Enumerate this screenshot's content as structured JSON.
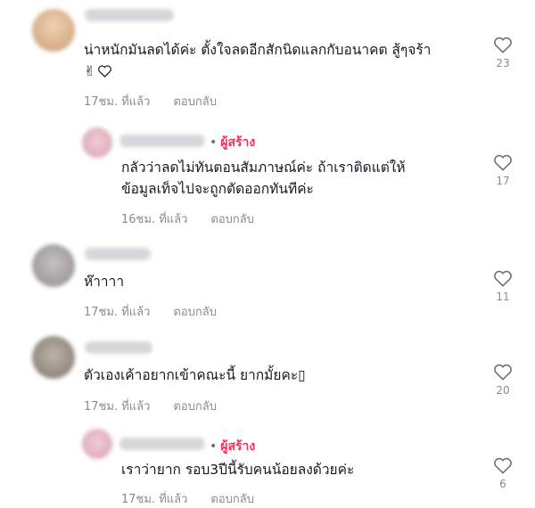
{
  "comments": [
    {
      "line1": "น่าหนักมันลดได้ค่ะ ตั้งใจลดอีกสักนิดแลกกับอนาคต สู้ๆจร้า",
      "line2": "✌",
      "time": "17ชม. ที่แล้ว",
      "reply": "ตอบกลับ",
      "likes": "23",
      "avatar_color": "#d9b48f"
    },
    {
      "creator_label": "ผู้สร้าง",
      "line1": "กลัวว่าลดไม่ทันตอนสัมภาษณ์ค่ะ ถ้าเราติดแต่ให้",
      "line2": "ข้อมูลเท็จไปจะถูกตัดออกทันทีค่ะ",
      "time": "16ชม. ที่แล้ว",
      "reply": "ตอบกลับ",
      "likes": "17",
      "avatar_color": "#e3b9c4"
    },
    {
      "line1": "ห๊าาาา",
      "time": "17ชม. ที่แล้ว",
      "reply": "ตอบกลับ",
      "likes": "11",
      "avatar_color": "#a9a5a5"
    },
    {
      "line1": "ตัวเองเค้าอยากเข้าคณะนี้ ยากมั้ยคะ▯",
      "time": "17ชม. ที่แล้ว",
      "reply": "ตอบกลับ",
      "likes": "20",
      "avatar_color": "#9a9188"
    },
    {
      "creator_label": "ผู้สร้าง",
      "line1": "เราว่ายาก รอบ3ปีนี้รับคนน้อยลงด้วยค่ะ",
      "time": "17ชม. ที่แล้ว",
      "reply": "ตอบกลับ",
      "likes": "6",
      "avatar_color": "#e3b9c4"
    }
  ],
  "icons": {
    "like": "heart-outline-icon",
    "creator_separator": "•"
  },
  "colors": {
    "creator": "#fe2c55",
    "meta": "#8a8b91",
    "text": "#161823"
  }
}
